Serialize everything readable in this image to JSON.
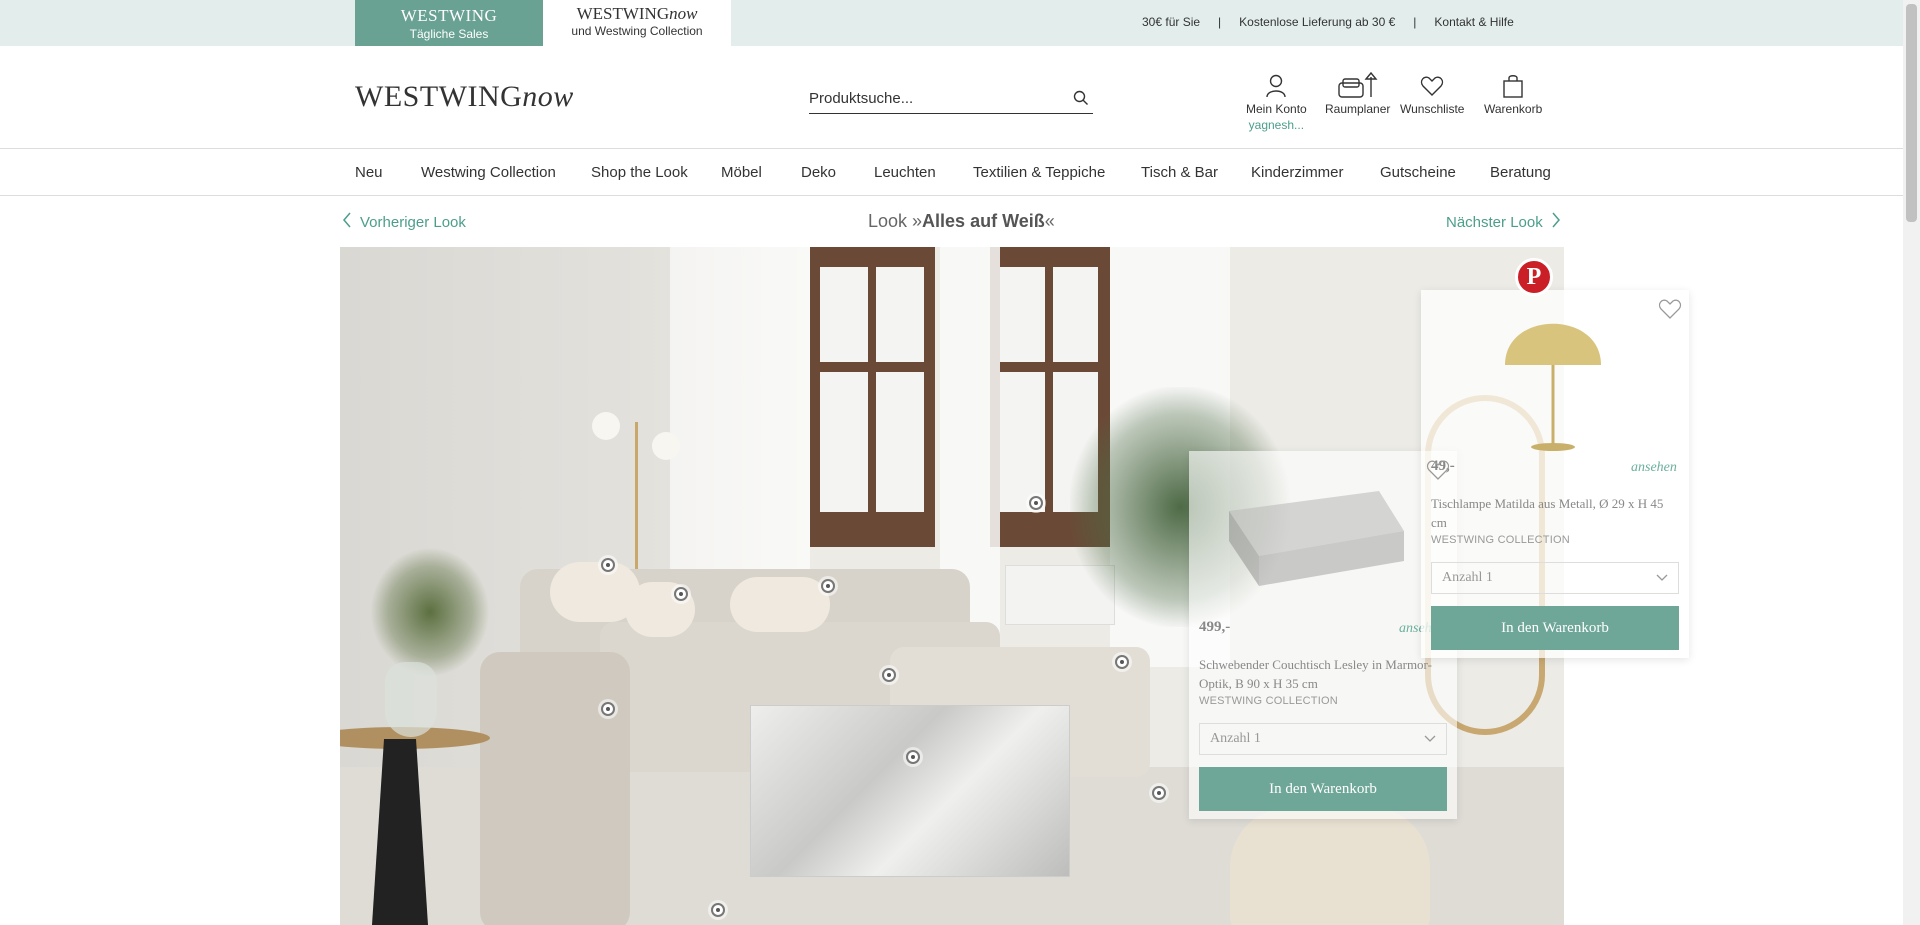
{
  "topbar": {
    "daily_brand": "WESTWING",
    "daily_sub": "Tägliche Sales",
    "now_brand_a": "WESTWING",
    "now_brand_b": "now",
    "now_sub": "und Westwing Collection",
    "links": [
      "30€ für Sie",
      "Kostenlose Lieferung ab 30 €",
      "Kontakt & Hilfe"
    ],
    "separator": "|"
  },
  "header": {
    "logo_a": "WESTWING",
    "logo_b": "now",
    "search_placeholder": "Produktsuche...",
    "account_label": "Mein Konto",
    "account_user": "yagnesh...",
    "planner_label": "Raumplaner",
    "wishlist_label": "Wunschliste",
    "cart_label": "Warenkorb"
  },
  "nav": {
    "items": [
      "Neu",
      "Westwing Collection",
      "Shop the Look",
      "Möbel",
      "Deko",
      "Leuchten",
      "Textilien & Teppiche",
      "Tisch & Bar",
      "Kinderzimmer",
      "Gutscheine",
      "Beratung"
    ]
  },
  "look": {
    "prev": "Vorheriger Look",
    "next": "Nächster Look",
    "title_prefix": "Look »",
    "title_name": "Alles auf Weiß",
    "title_suffix": "«"
  },
  "products": [
    {
      "price": "499,-",
      "view": "ansehen",
      "name": "Schwebender Couchtisch Lesley in Marmor-Optik, B 90 x H 35 cm",
      "brand": "WESTWING COLLECTION",
      "qty": "Anzahl 1",
      "cta": "In den Warenkorb"
    },
    {
      "price": "49,-",
      "view": "ansehen",
      "name": "Tischlampe Matilda aus Metall, Ø 29 x H 45 cm",
      "brand": "WESTWING COLLECTION",
      "qty": "Anzahl 1",
      "cta": "In den Warenkorb"
    }
  ],
  "pinterest_glyph": "P",
  "colors": {
    "accent": "#69a192",
    "topbar": "#e3eeec",
    "link": "#4c9e8b"
  }
}
